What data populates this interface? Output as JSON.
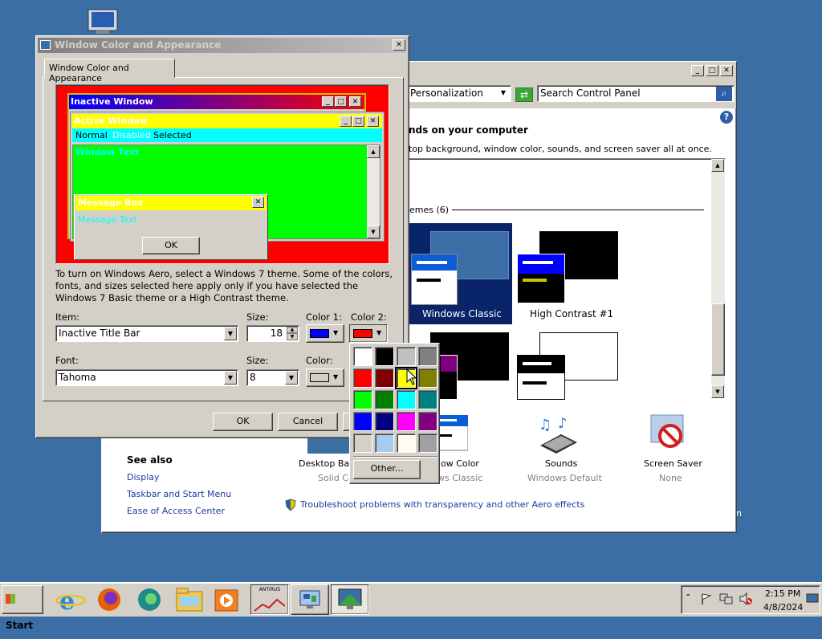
{
  "desktop": {
    "icon_name": "computer-icon"
  },
  "cp_window": {
    "address": "Personalization",
    "search_placeholder": "Search Control Panel",
    "heading": "nds on your computer",
    "description": "top background, window color, sounds, and screen saver all at once.",
    "themes_group": "emes (6)",
    "themes": [
      {
        "label": "Windows Classic"
      },
      {
        "label": "High Contrast #1"
      }
    ],
    "bottom_items": [
      {
        "label": "Desktop Back",
        "sub": "Solid Col"
      },
      {
        "label": "ow Color",
        "sub": "ws Classic"
      },
      {
        "label": "Sounds",
        "sub": "Windows Default"
      },
      {
        "label": "Screen Saver",
        "sub": "None"
      }
    ],
    "see_also_title": "See also",
    "see_also": [
      "Display",
      "Taskbar and Start Menu",
      "Ease of Access Center"
    ],
    "troubleshoot": "Troubleshoot problems with transparency and other Aero effects",
    "edge_char": "n"
  },
  "dialog": {
    "title": "Window Color and Appearance",
    "tab": "Window Color and Appearance",
    "preview": {
      "inactive_title": "Inactive Window",
      "active_title": "Active Window",
      "menu": [
        "Normal",
        "Disabled",
        "Selected"
      ],
      "window_text": "Window Text",
      "msgbox_title": "Message Box",
      "msgbox_text": "Message Text",
      "ok": "OK"
    },
    "info": "To turn on Windows Aero, select a Windows 7 theme.  Some of the colors, fonts, and sizes selected here apply only if you have selected the Windows 7 Basic theme or a High Contrast theme.",
    "item_label": "Item:",
    "item_value": "Inactive Title Bar",
    "size_label": "Size:",
    "size_value": "18",
    "color1_label": "Color 1:",
    "color2_label": "Color 2:",
    "font_label": "Font:",
    "font_value": "Tahoma",
    "font_size_label": "Size:",
    "font_size_value": "8",
    "font_color_label": "Color:",
    "ok": "OK",
    "cancel": "Cancel",
    "colors": {
      "color1": "#0000ff",
      "color2": "#ff0000",
      "font_color": "#d4d0c8"
    }
  },
  "palette": {
    "colors": [
      "#ffffff",
      "#000000",
      "#c0c0c0",
      "#808080",
      "#ff0000",
      "#800000",
      "#ffff00",
      "#808000",
      "#00ff00",
      "#008000",
      "#00ffff",
      "#008080",
      "#0000ff",
      "#000080",
      "#ff00ff",
      "#800080",
      "#d4d0c8",
      "#a6caf0",
      "#fffbf0",
      "#a0a0a4"
    ],
    "selected_index": 6,
    "other": "Other..."
  },
  "taskbar": {
    "start": "Start",
    "apps": [
      "internet-explorer-icon",
      "firefox-icon",
      "edge-icon",
      "file-explorer-icon",
      "media-player-icon",
      "antivirus-icon",
      "control-panel-icon",
      "display-properties-icon"
    ],
    "antivirus_label": "ANTIRUS",
    "time": "2:15 PM",
    "date": "4/8/2024"
  }
}
